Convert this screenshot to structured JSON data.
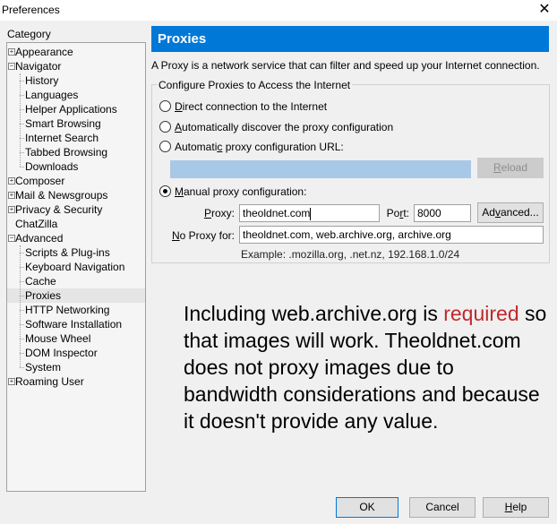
{
  "window": {
    "title": "Preferences",
    "close_icon": "close-icon"
  },
  "sidebar": {
    "label": "Category",
    "items": [
      {
        "label": "Appearance",
        "level": 0,
        "twisty": "+"
      },
      {
        "label": "Navigator",
        "level": 0,
        "twisty": "-"
      },
      {
        "label": "History",
        "level": 1
      },
      {
        "label": "Languages",
        "level": 1
      },
      {
        "label": "Helper Applications",
        "level": 1
      },
      {
        "label": "Smart Browsing",
        "level": 1
      },
      {
        "label": "Internet Search",
        "level": 1
      },
      {
        "label": "Tabbed Browsing",
        "level": 1
      },
      {
        "label": "Downloads",
        "level": 1
      },
      {
        "label": "Composer",
        "level": 0,
        "twisty": "+"
      },
      {
        "label": "Mail & Newsgroups",
        "level": 0,
        "twisty": "+"
      },
      {
        "label": "Privacy & Security",
        "level": 0,
        "twisty": "+"
      },
      {
        "label": "ChatZilla",
        "level": 0
      },
      {
        "label": "Advanced",
        "level": 0,
        "twisty": "-"
      },
      {
        "label": "Scripts & Plug-ins",
        "level": 1
      },
      {
        "label": "Keyboard Navigation",
        "level": 1
      },
      {
        "label": "Cache",
        "level": 1
      },
      {
        "label": "Proxies",
        "level": 1,
        "selected": true
      },
      {
        "label": "HTTP Networking",
        "level": 1
      },
      {
        "label": "Software Installation",
        "level": 1
      },
      {
        "label": "Mouse Wheel",
        "level": 1
      },
      {
        "label": "DOM Inspector",
        "level": 1
      },
      {
        "label": "System",
        "level": 1
      },
      {
        "label": "Roaming User",
        "level": 0,
        "twisty": "+"
      }
    ]
  },
  "main": {
    "header": "Proxies",
    "description": "A Proxy is a network service that can filter and speed up your Internet connection.",
    "group_title": "Configure Proxies to Access the Internet",
    "options": {
      "direct": {
        "accel": "D",
        "rest": "irect connection to the Internet",
        "checked": false
      },
      "auto_discover": {
        "accel": "A",
        "rest": "utomatically discover the proxy configuration",
        "checked": false
      },
      "auto_url": {
        "pre": "Automati",
        "accel": "c",
        "rest": " proxy configuration URL:",
        "checked": false
      },
      "manual": {
        "accel": "M",
        "rest": "anual proxy configuration:",
        "checked": true
      }
    },
    "auto_url_value": "",
    "reload_button": {
      "accel": "R",
      "rest": "eload"
    },
    "proxy_label": {
      "accel": "P",
      "rest": "roxy:"
    },
    "proxy_value": "theoldnet.com",
    "port_label": {
      "pre": "Po",
      "accel": "r",
      "rest": "t:"
    },
    "port_value": "8000",
    "advanced_button": {
      "pre": "Ad",
      "accel": "v",
      "rest": "anced..."
    },
    "no_proxy_label": {
      "accel": "N",
      "rest": "o Proxy for:"
    },
    "no_proxy_value": "theoldnet.com, web.archive.org, archive.org",
    "example": "Example: .mozilla.org, .net.nz, 192.168.1.0/24"
  },
  "annotation": {
    "part1": "Including web.archive.org is ",
    "highlight": "required",
    "part2": " so that images will work. Theoldnet.com does not proxy images due to bandwidth considerations and because it doesn't provide any value.",
    "highlight_color": "#c0282c"
  },
  "footer": {
    "ok": "OK",
    "cancel": "Cancel",
    "help": {
      "accel": "H",
      "rest": "elp"
    }
  }
}
